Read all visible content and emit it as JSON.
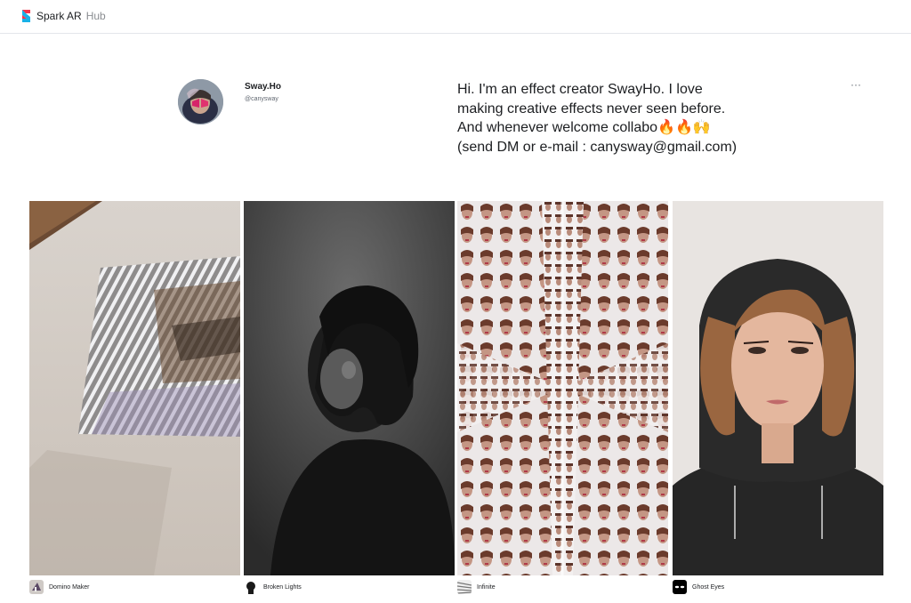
{
  "header": {
    "brand_name": "Spark AR",
    "brand_sub": "Hub",
    "logo_icon": "spark-ar-logo-icon",
    "accent_colors": [
      "#f5334a",
      "#18b1e7"
    ]
  },
  "profile": {
    "name": "Sway.Ho",
    "handle": "@canysway",
    "bio": "Hi. I'm an effect creator SwayHo. I love\nmaking creative effects never seen before.\nAnd whenever welcome collabo🔥🔥🙌\n(send DM or e-mail : canysway@gmail.com)",
    "more_label": "···"
  },
  "effects": [
    {
      "name": "Domino Maker",
      "icon": "domino-maker-thumb-icon"
    },
    {
      "name": "Broken Lights",
      "icon": "broken-lights-thumb-icon"
    },
    {
      "name": "Infinite",
      "icon": "infinite-thumb-icon"
    },
    {
      "name": "Ghost Eyes",
      "icon": "ghost-eyes-thumb-icon"
    }
  ]
}
